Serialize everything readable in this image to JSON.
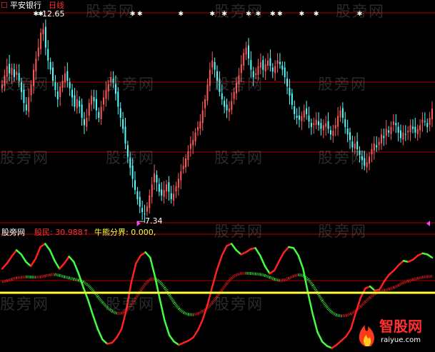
{
  "header": {
    "checkbox_symbol": "☐",
    "stock_name": "平安银行",
    "period": "日线",
    "high_marker": "12.65",
    "low_marker": "7.34"
  },
  "indicator": {
    "name": "股旁网",
    "field1_label": "股民",
    "field1_value": "30.988",
    "field1_arrow": "↑",
    "field2_label": "牛熊分界",
    "field2_value": "0.000,"
  },
  "watermark": "股旁网",
  "logo": {
    "title": "智股网",
    "url": "raiyue.com"
  },
  "colors": {
    "background": "#000000",
    "up_candle": "#ff5a5a",
    "down_candle": "#54ffff",
    "gridline": "#b00000",
    "rising_line": "#ff2020",
    "falling_line": "#40ff40",
    "boundary_line": "#ffff40",
    "label_white": "#ffffff",
    "label_red": "#ff3030",
    "label_yellow": "#ffff40",
    "marker_magenta": "#ff40ff"
  },
  "chart_data": [
    {
      "type": "candlestick",
      "title": "平安银行 日线",
      "ylim": [
        7.2,
        12.8
      ],
      "price_high": 12.65,
      "price_low": 7.34,
      "top_signal_glyph": "✱",
      "top_signal_indices": [
        14,
        16,
        54,
        57,
        74,
        87,
        92,
        102,
        106,
        112,
        115,
        124,
        130,
        148
      ],
      "close": [
        10.9,
        11.15,
        11.4,
        11.2,
        11.35,
        11.1,
        11.25,
        11.0,
        10.7,
        10.4,
        10.2,
        10.55,
        10.9,
        11.3,
        11.6,
        11.9,
        12.3,
        12.4,
        11.9,
        11.55,
        11.3,
        11.0,
        10.75,
        10.5,
        10.85,
        11.0,
        11.2,
        11.0,
        10.8,
        10.55,
        10.3,
        10.5,
        10.3,
        10.0,
        9.8,
        10.0,
        10.4,
        10.6,
        10.45,
        10.2,
        10.0,
        10.3,
        10.55,
        10.75,
        10.9,
        11.1,
        10.95,
        10.65,
        10.3,
        10.0,
        9.7,
        9.3,
        8.95,
        8.65,
        8.35,
        8.05,
        7.8,
        7.6,
        7.45,
        7.4,
        7.6,
        7.9,
        8.2,
        8.5,
        8.25,
        8.0,
        7.9,
        8.05,
        8.2,
        8.0,
        7.8,
        7.95,
        8.15,
        8.35,
        8.55,
        8.7,
        8.9,
        9.1,
        9.3,
        9.4,
        9.6,
        9.75,
        9.9,
        10.2,
        10.5,
        10.9,
        11.3,
        11.55,
        11.3,
        11.0,
        10.7,
        10.5,
        10.3,
        10.2,
        10.25,
        10.45,
        10.7,
        10.95,
        11.15,
        11.45,
        11.75,
        11.9,
        11.6,
        11.3,
        11.1,
        11.2,
        11.4,
        11.5,
        11.3,
        11.45,
        11.55,
        11.4,
        11.25,
        11.4,
        11.55,
        11.45,
        11.3,
        11.1,
        10.85,
        10.6,
        10.35,
        10.1,
        10.0,
        9.95,
        10.05,
        10.2,
        10.1,
        9.9,
        9.75,
        9.85,
        9.95,
        9.8,
        9.7,
        9.8,
        9.85,
        9.7,
        9.55,
        9.65,
        9.8,
        10.05,
        10.2,
        10.0,
        9.75,
        9.55,
        9.4,
        9.2,
        9.3,
        9.15,
        9.0,
        8.85,
        8.7,
        8.8,
        8.95,
        9.15,
        9.3,
        9.2,
        9.35,
        9.55,
        9.45,
        9.7,
        9.6,
        9.75,
        9.9,
        9.8,
        9.6,
        9.45,
        9.6,
        9.55,
        9.65,
        9.8,
        9.7,
        9.6,
        9.7,
        9.8,
        9.95,
        9.9,
        9.75,
        10.0,
        10.25
      ]
    },
    {
      "type": "line",
      "title": "股旁网 股民 30.988 牛熊分界 0.000",
      "ylim": [
        -110,
        110
      ],
      "boundary_level": 0,
      "series": [
        {
          "name": "股民",
          "values": [
            45,
            55,
            68,
            80,
            72,
            58,
            50,
            64,
            86,
            92,
            80,
            60,
            45,
            55,
            68,
            58,
            36,
            10,
            -14,
            -42,
            -68,
            -88,
            -96,
            -94,
            -84,
            -68,
            -32,
            18,
            55,
            70,
            76,
            66,
            30,
            -12,
            -52,
            -80,
            -92,
            -98,
            -94,
            -90,
            -84,
            -70,
            -50,
            -22,
            12,
            44,
            70,
            88,
            92,
            80,
            72,
            76,
            82,
            84,
            70,
            50,
            36,
            42,
            60,
            76,
            86,
            84,
            70,
            45,
            0,
            -40,
            -74,
            -92,
            -100,
            -104,
            -98,
            -90,
            -82,
            -68,
            -38,
            -10,
            8,
            12,
            4,
            6,
            22,
            34,
            42,
            52,
            60,
            58,
            62,
            70,
            74,
            72,
            66
          ]
        },
        {
          "name": "牛熊分界",
          "values": [
            0
          ]
        }
      ]
    }
  ]
}
